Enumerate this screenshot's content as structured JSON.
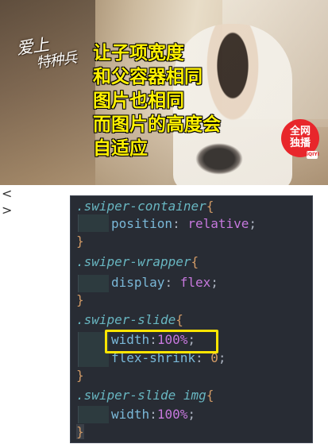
{
  "banner": {
    "logo_line1": "爱上",
    "logo_line2": "特种兵",
    "caption_lines": [
      "让子项宽度",
      "和父容器相同",
      "图片也相同",
      "而图片的高度会",
      "自适应"
    ],
    "badge_line1": "全网",
    "badge_line2": "独播",
    "badge_sub": "iQIYI"
  },
  "nav": {
    "prev": "<",
    "next": ">"
  },
  "code": {
    "rules": [
      {
        "selector": ".swiper-container",
        "open": "{",
        "decls": [
          {
            "prop": "position",
            "value": "relative"
          }
        ]
      },
      {
        "selector": ".swiper-wrapper",
        "open": "{",
        "decls": [
          {
            "prop": "display",
            "value": "flex"
          }
        ]
      },
      {
        "selector": ".swiper-slide",
        "open": "{",
        "decls": [
          {
            "prop": "width",
            "value": "100%"
          },
          {
            "prop": "flex-shrink",
            "value": "0"
          }
        ]
      },
      {
        "selector": ".swiper-slide img",
        "open": "{",
        "decls": [
          {
            "prop": "width",
            "value": "100%"
          }
        ]
      }
    ],
    "close": "}",
    "colon": ":",
    "semicolon": ";",
    "highlighted_declaration": "width:100%;"
  },
  "colors": {
    "editor_bg": "#282c34",
    "selector": "#68b6c1",
    "property": "#7ab8d8",
    "value": "#c678dd",
    "brace": "#d19a66",
    "highlight": "#ffe500",
    "caption": "#fff200"
  }
}
